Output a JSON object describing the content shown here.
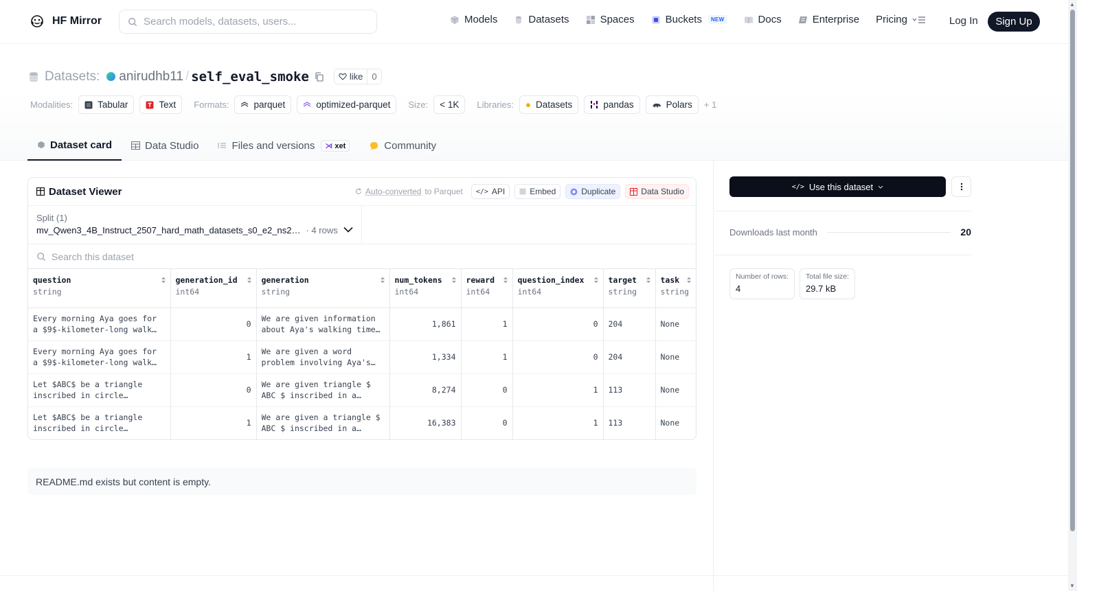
{
  "nav": {
    "brand": "HF Mirror",
    "search_placeholder": "Search models, datasets, users...",
    "links": [
      {
        "label": "Models",
        "icon": "cube-icon"
      },
      {
        "label": "Datasets",
        "icon": "database-icon"
      },
      {
        "label": "Spaces",
        "icon": "grid-icon"
      },
      {
        "label": "Buckets",
        "icon": "bucket-icon",
        "badge": "NEW"
      },
      {
        "label": "Docs",
        "icon": "book-icon"
      },
      {
        "label": "Enterprise",
        "icon": "enterprise-icon"
      },
      {
        "label": "Pricing"
      }
    ],
    "login": "Log In",
    "signup": "Sign Up"
  },
  "header": {
    "crumb_label": "Datasets:",
    "owner": "anirudhb11",
    "slash": "/",
    "repo": "self_eval_smoke",
    "like_label": "like",
    "like_count": "0",
    "modalities_label": "Modalities:",
    "modalities": [
      "Tabular",
      "Text"
    ],
    "formats_label": "Formats:",
    "formats": [
      "parquet",
      "optimized-parquet"
    ],
    "size_label": "Size:",
    "size": "< 1K",
    "libraries_label": "Libraries:",
    "libraries": [
      "Datasets",
      "pandas",
      "Polars"
    ],
    "more_libraries": "+ 1"
  },
  "tabs": [
    {
      "label": "Dataset card",
      "active": true
    },
    {
      "label": "Data Studio"
    },
    {
      "label": "Files and versions",
      "badge": "xet"
    },
    {
      "label": "Community"
    }
  ],
  "viewer": {
    "title": "Dataset Viewer",
    "auto_converted": "Auto-converted",
    "auto_converted_suffix": "to Parquet",
    "actions": [
      "API",
      "Embed",
      "Duplicate",
      "Data Studio"
    ],
    "split_label": "Split (1)",
    "split_value": "mv_Qwen3_4B_Instruct_2507_hard_math_datasets_s0_e2_ns2…",
    "split_rows": "· 4 rows",
    "search_placeholder": "Search this dataset",
    "columns": [
      {
        "name": "question",
        "type": "string"
      },
      {
        "name": "generation_id",
        "type": "int64"
      },
      {
        "name": "generation",
        "type": "string"
      },
      {
        "name": "num_tokens",
        "type": "int64"
      },
      {
        "name": "reward",
        "type": "int64"
      },
      {
        "name": "question_index",
        "type": "int64"
      },
      {
        "name": "target",
        "type": "string"
      },
      {
        "name": "task",
        "type": "string"
      }
    ],
    "rows": [
      [
        "Every morning Aya goes for a $9$-kilometer-long walk…",
        "0",
        "We are given information about Aya's walking time…",
        "1,861",
        "1",
        "0",
        "204",
        "None"
      ],
      [
        "Every morning Aya goes for a $9$-kilometer-long walk…",
        "1",
        "We are given a word problem involving Aya's…",
        "1,334",
        "1",
        "0",
        "204",
        "None"
      ],
      [
        "Let $ABC$ be a triangle inscribed in circle…",
        "0",
        "We are given triangle $ ABC $ inscribed in a…",
        "8,274",
        "0",
        "1",
        "113",
        "None"
      ],
      [
        "Let $ABC$ be a triangle inscribed in circle…",
        "1",
        "We are given a triangle $ ABC $ inscribed in a…",
        "16,383",
        "0",
        "1",
        "113",
        "None"
      ]
    ]
  },
  "readme_note": "README.md exists but content is empty.",
  "sidebar": {
    "use_button": "Use this dataset",
    "downloads_label": "Downloads last month",
    "downloads_value": "20",
    "stats": [
      {
        "label": "Number of rows:",
        "value": "4"
      },
      {
        "label": "Total file size:",
        "value": "29.7 kB"
      }
    ]
  }
}
